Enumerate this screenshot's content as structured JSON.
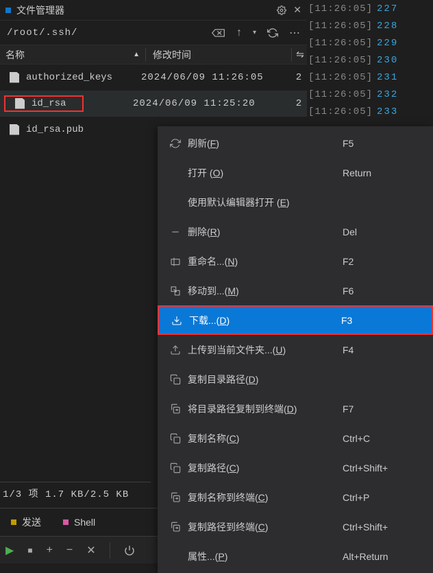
{
  "header": {
    "title": "文件管理器"
  },
  "path": "/root/.ssh/",
  "columns": {
    "name": "名称",
    "mtime": "修改时间",
    "sortArrow": "▲"
  },
  "files": [
    {
      "name": "authorized_keys",
      "mtime": "2024/06/09 11:26:05",
      "selected": false,
      "redbox": false
    },
    {
      "name": "id_rsa",
      "mtime": "2024/06/09 11:25:20",
      "selected": true,
      "redbox": true
    },
    {
      "name": "id_rsa.pub",
      "mtime": "",
      "selected": false,
      "redbox": false
    }
  ],
  "status": "1/3 项 1.7 KB/2.5 KB",
  "tabs": [
    {
      "label": "发送",
      "color": "yellow"
    },
    {
      "label": "Shell",
      "color": "pink"
    }
  ],
  "terminal": [
    {
      "time": "[11:26:05]",
      "line": "227"
    },
    {
      "time": "[11:26:05]",
      "line": "228"
    },
    {
      "time": "[11:26:05]",
      "line": "229"
    },
    {
      "time": "[11:26:05]",
      "line": "230"
    },
    {
      "time": "[11:26:05]",
      "line": "231"
    },
    {
      "time": "[11:26:05]",
      "line": "232"
    },
    {
      "time": "[11:26:05]",
      "line": "233"
    }
  ],
  "menu": [
    {
      "icon": "refresh",
      "label_pre": "刷新(",
      "mn": "F",
      "label_post": ")",
      "shortcut": "F5"
    },
    {
      "icon": "",
      "label_pre": "打开 (",
      "mn": "O",
      "label_post": ")",
      "shortcut": "Return"
    },
    {
      "icon": "",
      "label_pre": "使用默认编辑器打开 (",
      "mn": "E",
      "label_post": ")",
      "shortcut": ""
    },
    {
      "icon": "minus",
      "label_pre": "删除(",
      "mn": "R",
      "label_post": ")",
      "shortcut": "Del"
    },
    {
      "icon": "rename",
      "label_pre": "重命名...(",
      "mn": "N",
      "label_post": ")",
      "shortcut": "F2"
    },
    {
      "icon": "moveto",
      "label_pre": "移动到...(",
      "mn": "M",
      "label_post": ")",
      "shortcut": "F6"
    },
    {
      "icon": "download",
      "label_pre": "下载...(",
      "mn": "D",
      "label_post": ")",
      "shortcut": "F3",
      "highlight": true
    },
    {
      "icon": "upload",
      "label_pre": "上传到当前文件夹...(",
      "mn": "U",
      "label_post": ")",
      "shortcut": "F4"
    },
    {
      "icon": "copy",
      "label_pre": "复制目录路径(",
      "mn": "D",
      "label_post": ")",
      "shortcut": ""
    },
    {
      "icon": "copyto",
      "label_pre": "将目录路径复制到终端(",
      "mn": "D",
      "label_post": ")",
      "shortcut": "F7"
    },
    {
      "icon": "copy",
      "label_pre": "复制名称(",
      "mn": "C",
      "label_post": ")",
      "shortcut": "Ctrl+C"
    },
    {
      "icon": "copy",
      "label_pre": "复制路径(",
      "mn": "C",
      "label_post": ")",
      "shortcut": "Ctrl+Shift+"
    },
    {
      "icon": "copyto",
      "label_pre": "复制名称到终端(",
      "mn": "C",
      "label_post": ")",
      "shortcut": "Ctrl+P"
    },
    {
      "icon": "copyto",
      "label_pre": "复制路径到终端(",
      "mn": "C",
      "label_post": ")",
      "shortcut": "Ctrl+Shift+"
    },
    {
      "icon": "",
      "label_pre": "属性...(",
      "mn": "P",
      "label_post": ")",
      "shortcut": "Alt+Return"
    }
  ]
}
